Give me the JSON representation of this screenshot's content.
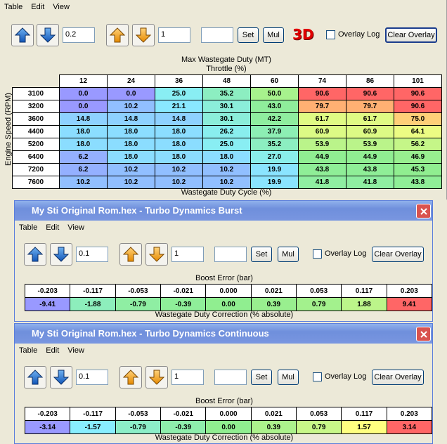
{
  "main": {
    "menu": [
      "Table",
      "Edit",
      "View"
    ],
    "step_value_1": "0.2",
    "step_value_2": "1",
    "set_label": "Set",
    "mul_label": "Mul",
    "three_d_label": "3D",
    "overlay_log_label": "Overlay Log",
    "clear_overlay_label": "Clear Overlay",
    "title": "Max Wastegate Duty (MT)",
    "x_axis_label": "Throttle (%)",
    "y_axis_label": "Engine Speed (RPM)",
    "value_label": "Wastegate Duty Cycle (%)",
    "columns": [
      "12",
      "24",
      "36",
      "48",
      "60",
      "74",
      "86",
      "101"
    ],
    "rows": [
      {
        "rpm": "3100",
        "cells": [
          "0.0",
          "0.0",
          "25.0",
          "35.2",
          "50.0",
          "90.6",
          "90.6",
          "90.6"
        ]
      },
      {
        "rpm": "3200",
        "cells": [
          "0.0",
          "10.2",
          "21.1",
          "30.1",
          "43.0",
          "79.7",
          "79.7",
          "90.6"
        ]
      },
      {
        "rpm": "3600",
        "cells": [
          "14.8",
          "14.8",
          "14.8",
          "30.1",
          "42.2",
          "61.7",
          "61.7",
          "75.0"
        ]
      },
      {
        "rpm": "4400",
        "cells": [
          "18.0",
          "18.0",
          "18.0",
          "26.2",
          "37.9",
          "60.9",
          "60.9",
          "64.1"
        ]
      },
      {
        "rpm": "5200",
        "cells": [
          "18.0",
          "18.0",
          "18.0",
          "25.0",
          "35.2",
          "53.9",
          "53.9",
          "56.2"
        ]
      },
      {
        "rpm": "6400",
        "cells": [
          "6.2",
          "18.0",
          "18.0",
          "18.0",
          "27.0",
          "44.9",
          "44.9",
          "46.9"
        ]
      },
      {
        "rpm": "7200",
        "cells": [
          "6.2",
          "10.2",
          "10.2",
          "10.2",
          "19.9",
          "43.8",
          "43.8",
          "45.3"
        ]
      },
      {
        "rpm": "7600",
        "cells": [
          "10.2",
          "10.2",
          "10.2",
          "10.2",
          "19.9",
          "41.8",
          "41.8",
          "43.8"
        ]
      }
    ]
  },
  "burst": {
    "window_title": "My Sti Original Rom.hex - Turbo Dynamics Burst",
    "menu": [
      "Table",
      "Edit",
      "View"
    ],
    "step_value_1": "0.1",
    "step_value_2": "1",
    "set_label": "Set",
    "mul_label": "Mul",
    "overlay_log_label": "Overlay Log",
    "clear_overlay_label": "Clear Overlay",
    "x_axis_label": "Boost Error (bar)",
    "value_label": "Wastegate Duty Correction (% absolute)",
    "columns": [
      "-0.203",
      "-0.117",
      "-0.053",
      "-0.021",
      "0.000",
      "0.021",
      "0.053",
      "0.117",
      "0.203"
    ],
    "values": [
      "-9.41",
      "-1.88",
      "-0.79",
      "-0.39",
      "0.00",
      "0.39",
      "0.79",
      "1.88",
      "9.41"
    ]
  },
  "continuous": {
    "window_title": "My Sti Original Rom.hex - Turbo Dynamics Continuous",
    "menu": [
      "Table",
      "Edit",
      "View"
    ],
    "step_value_1": "0.1",
    "step_value_2": "1",
    "set_label": "Set",
    "mul_label": "Mul",
    "overlay_log_label": "Overlay Log",
    "clear_overlay_label": "Clear Overlay",
    "x_axis_label": "Boost Error (bar)",
    "value_label": "Wastegate Duty Correction (% absolute)",
    "columns": [
      "-0.203",
      "-0.117",
      "-0.053",
      "-0.021",
      "0.000",
      "0.021",
      "0.053",
      "0.117",
      "0.203"
    ],
    "values": [
      "-3.14",
      "-1.57",
      "-0.79",
      "-0.39",
      "0.00",
      "0.39",
      "0.79",
      "1.57",
      "3.14"
    ]
  },
  "colors": {
    "titlebar": "#7a98e0",
    "cell_low": "#9999ff",
    "cell_high": "#ff6666"
  }
}
